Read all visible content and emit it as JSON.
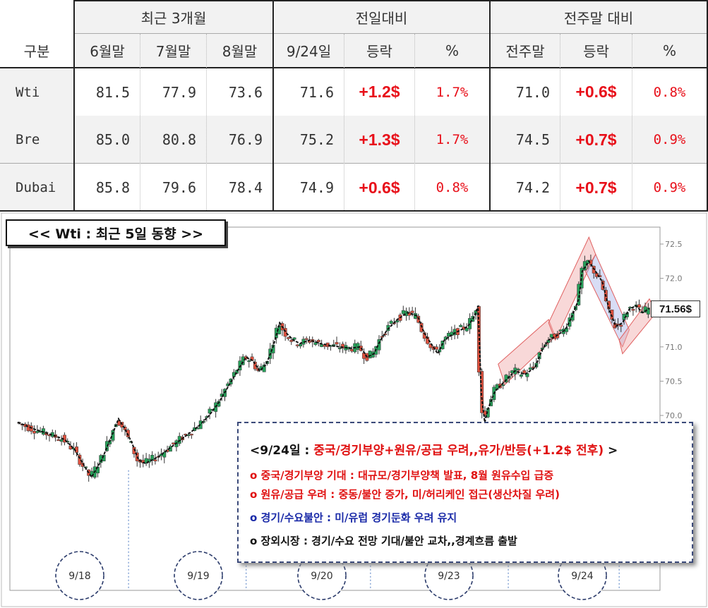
{
  "table": {
    "group_headers": {
      "recent": "최근 3개월",
      "prev_day": "전일대비",
      "prev_week": "전주말 대비"
    },
    "sub_headers": {
      "category": "구분",
      "jun": "6월말",
      "jul": "7월말",
      "aug": "8월말",
      "date": "9/24일",
      "chg": "등락",
      "pct": "%",
      "prev_week_end": "전주말",
      "chg2": "등락",
      "pct2": "%"
    },
    "rows": [
      {
        "name": "Wti",
        "jun": "81.5",
        "jul": "77.9",
        "aug": "73.6",
        "today": "71.6",
        "day_chg": "+1.2$",
        "day_pct": "1.7%",
        "week_end": "71.0",
        "week_chg": "+0.6$",
        "week_pct": "0.8%"
      },
      {
        "name": "Bre",
        "jun": "85.0",
        "jul": "80.8",
        "aug": "76.9",
        "today": "75.2",
        "day_chg": "+1.3$",
        "day_pct": "1.7%",
        "week_end": "74.5",
        "week_chg": "+0.7$",
        "week_pct": "0.9%"
      },
      {
        "name": "Dubai",
        "jun": "85.8",
        "jul": "79.6",
        "aug": "78.4",
        "today": "74.9",
        "day_chg": "+0.6$",
        "day_pct": "0.8%",
        "week_end": "74.2",
        "week_chg": "+0.7$",
        "week_pct": "0.9%"
      }
    ]
  },
  "chart_title": "<< Wti : 최근 5일 동향 >>",
  "last_price_label": "71.56$",
  "annotation": {
    "headline_prefix": "<9/24일 : ",
    "headline_red": "중국/경기부양+원유/공급 우려,,유가/반등(+1.2$ 전후)",
    "headline_suffix": " >",
    "items": [
      {
        "text": "o 중국/경기부양 기대 : 대규모/경기부양책 발표, 8월 원유수입 급증",
        "color": "red"
      },
      {
        "text": "o 원유/공급 우려 : 중동/불안 증가, 미/허리케인 접근(생산차질 우려)",
        "color": "red"
      },
      {
        "text": "o 경기/수요불안 : 미/유럽 경기둔화 우려 유지",
        "color": "blue"
      },
      {
        "text": "o 장외시장 : 경기/수요 전망 기대/불안 교차,,경계흐름 출발",
        "color": "black"
      }
    ]
  },
  "colors": {
    "up": "#27a05a",
    "down": "#e0523f",
    "ma": "#111111",
    "highlight_red": "#f0a8a8",
    "highlight_blue": "#a8b4e8",
    "text_red": "#e01010",
    "text_blue": "#1a2aa8"
  },
  "chart_data": {
    "type": "candlestick",
    "title": "<< Wti : 최근 5일 동향 >>",
    "y_ticks": [
      70.0,
      70.5,
      71.0,
      71.5,
      72.0,
      72.5
    ],
    "ylim": [
      69.0,
      72.55
    ],
    "day_labels": [
      "9/18",
      "9/19",
      "9/20",
      "9/23",
      "9/24"
    ],
    "last_price": 71.56,
    "close_path": [
      [
        0,
        69.9
      ],
      [
        5,
        69.8
      ],
      [
        10,
        69.72
      ],
      [
        14,
        69.65
      ],
      [
        17,
        69.5
      ],
      [
        20,
        69.25
      ],
      [
        22,
        69.1
      ],
      [
        25,
        69.35
      ],
      [
        28,
        69.7
      ],
      [
        30,
        69.95
      ],
      [
        32,
        69.8
      ],
      [
        34,
        69.6
      ],
      [
        36,
        69.35
      ],
      [
        38,
        69.3
      ],
      [
        42,
        69.4
      ],
      [
        46,
        69.55
      ],
      [
        50,
        69.7
      ],
      [
        54,
        69.85
      ],
      [
        57,
        70.0
      ],
      [
        60,
        70.2
      ],
      [
        63,
        70.45
      ],
      [
        66,
        70.7
      ],
      [
        68,
        70.85
      ],
      [
        70,
        70.8
      ],
      [
        72,
        70.65
      ],
      [
        74,
        70.75
      ],
      [
        76,
        71.0
      ],
      [
        78,
        71.35
      ],
      [
        80,
        71.2
      ],
      [
        82,
        71.1
      ],
      [
        84,
        71.05
      ],
      [
        87,
        71.1
      ],
      [
        90,
        71.05
      ],
      [
        93,
        71.02
      ],
      [
        96,
        71.0
      ],
      [
        99,
        70.98
      ],
      [
        102,
        71.0
      ],
      [
        104,
        70.85
      ],
      [
        106,
        70.9
      ],
      [
        108,
        71.1
      ],
      [
        110,
        71.25
      ],
      [
        113,
        71.4
      ],
      [
        116,
        71.5
      ],
      [
        119,
        71.45
      ],
      [
        121,
        71.2
      ],
      [
        123,
        71.05
      ],
      [
        125,
        70.9
      ],
      [
        127,
        71.1
      ],
      [
        130,
        71.2
      ],
      [
        132,
        71.25
      ],
      [
        134,
        71.3
      ],
      [
        136,
        71.45
      ],
      [
        137,
        71.6
      ],
      [
        138,
        70.3
      ],
      [
        139,
        69.9
      ],
      [
        140,
        70.1
      ],
      [
        142,
        70.35
      ],
      [
        145,
        70.5
      ],
      [
        148,
        70.65
      ],
      [
        151,
        70.6
      ],
      [
        154,
        70.7
      ],
      [
        156,
        70.95
      ],
      [
        158,
        71.1
      ],
      [
        160,
        71.15
      ],
      [
        163,
        71.25
      ],
      [
        165,
        71.45
      ],
      [
        167,
        71.7
      ],
      [
        168,
        72.1
      ],
      [
        170,
        72.25
      ],
      [
        172,
        72.1
      ],
      [
        174,
        71.95
      ],
      [
        176,
        71.55
      ],
      [
        178,
        71.3
      ],
      [
        180,
        71.35
      ],
      [
        182,
        71.55
      ],
      [
        184,
        71.6
      ],
      [
        186,
        71.5
      ],
      [
        188,
        71.56
      ]
    ],
    "x_domain": [
      0,
      188
    ],
    "day_boundaries": [
      33,
      68,
      105,
      146,
      179
    ]
  }
}
